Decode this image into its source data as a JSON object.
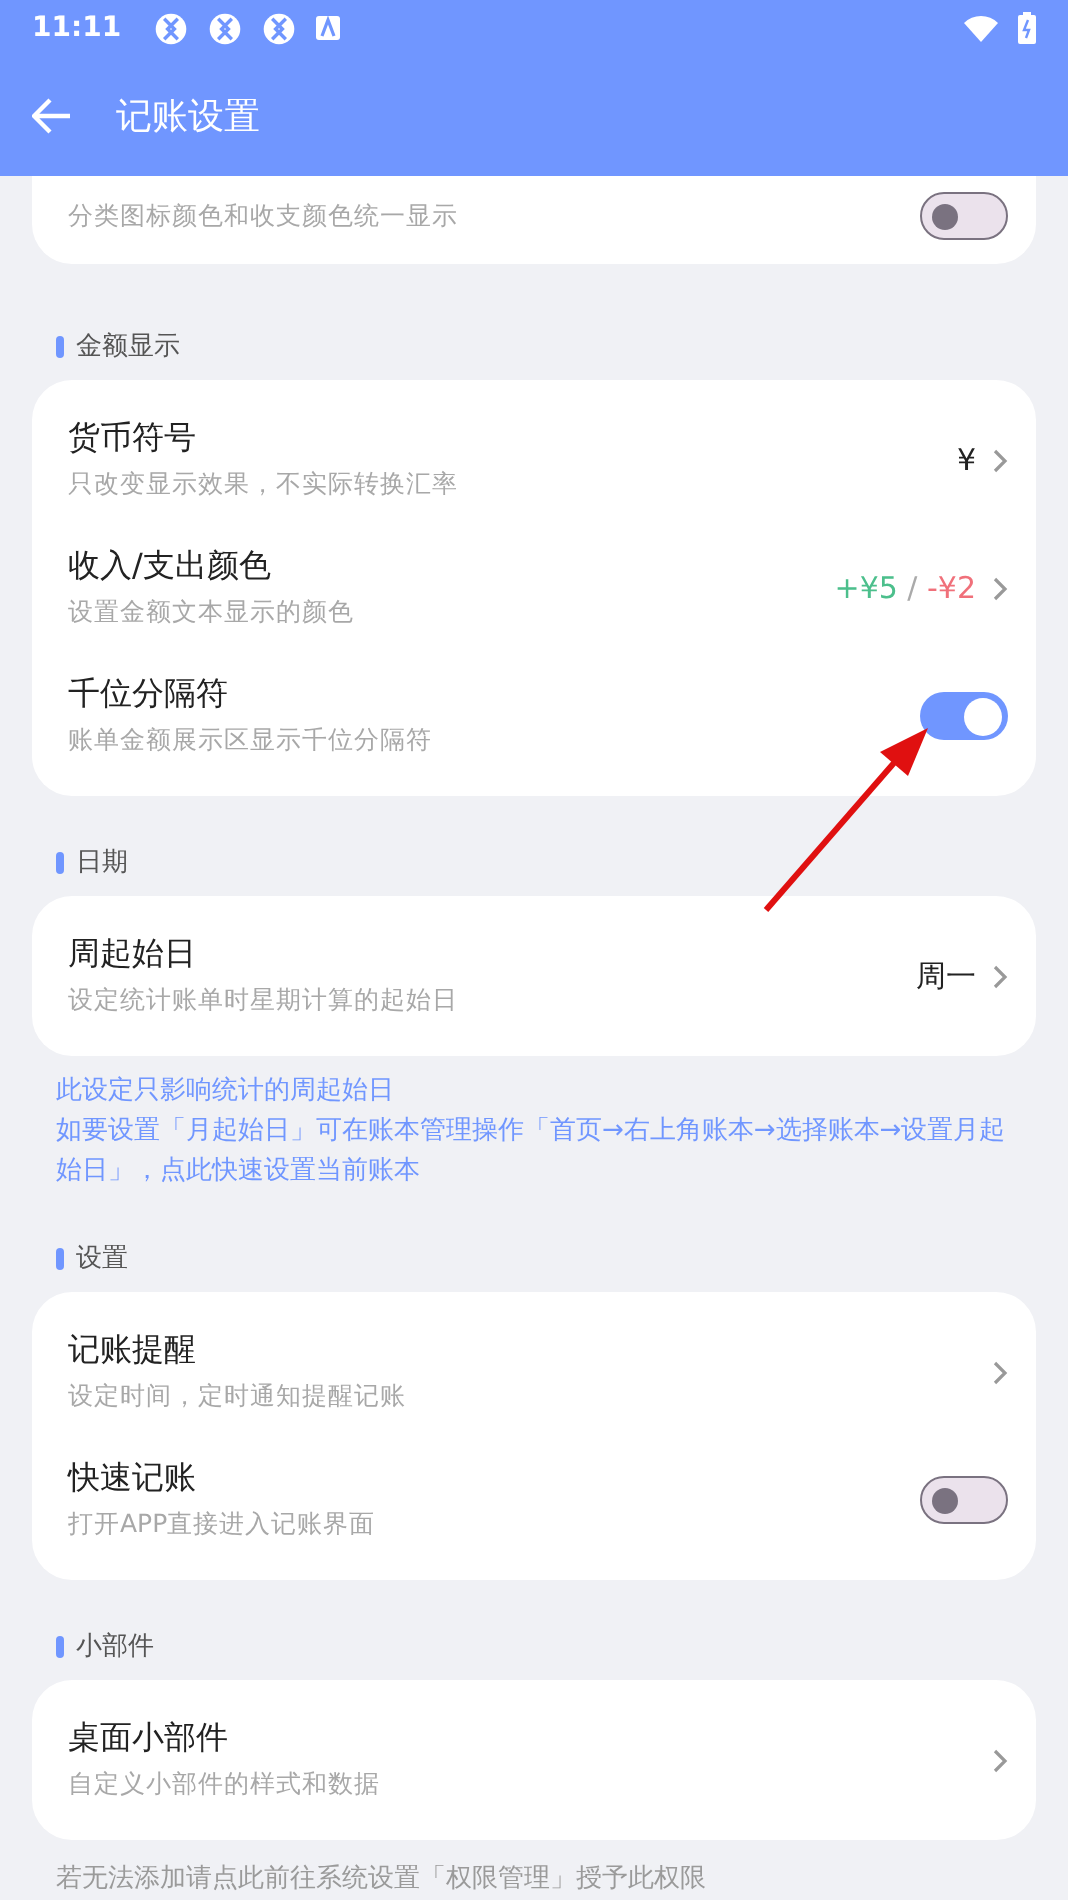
{
  "status_bar": {
    "time": "11:11"
  },
  "app_bar": {
    "title": "记账设置"
  },
  "top_partial_card": {
    "subtitle": "分类图标颜色和收支颜色统一显示",
    "on": false
  },
  "sections": [
    {
      "label": "金额显示",
      "items": [
        {
          "kind": "link",
          "title": "货币符号",
          "subtitle": "只改变显示效果，不实际转换汇率",
          "value_parts": [
            {
              "text": "¥",
              "color": "#222222"
            }
          ]
        },
        {
          "kind": "link",
          "title": "收入/支出颜色",
          "subtitle": "设置金额文本显示的颜色",
          "value_parts": [
            {
              "text": "+¥5",
              "color": "#4cbf8c"
            },
            {
              "text": " / ",
              "color": "#aaaaaa"
            },
            {
              "text": "-¥2",
              "color": "#f0707a"
            }
          ]
        },
        {
          "kind": "toggle",
          "title": "千位分隔符",
          "subtitle": "账单金额展示区显示千位分隔符",
          "on": true
        }
      ]
    },
    {
      "label": "日期",
      "items": [
        {
          "kind": "link",
          "title": "周起始日",
          "subtitle": "设定统计账单时星期计算的起始日",
          "value_parts": [
            {
              "text": "周一",
              "color": "#222222"
            }
          ]
        }
      ],
      "note_lines": [
        "此设定只影响统计的周起始日",
        "如要设置「月起始日」可在账本管理操作「首页→右上角账本→选择账本→设置月起始日」，点此快速设置当前账本"
      ]
    },
    {
      "label": "设置",
      "items": [
        {
          "kind": "link",
          "title": "记账提醒",
          "subtitle": "设定时间，定时通知提醒记账"
        },
        {
          "kind": "toggle",
          "title": "快速记账",
          "subtitle": "打开APP直接进入记账界面",
          "on": false
        }
      ]
    },
    {
      "label": "小部件",
      "items": [
        {
          "kind": "link",
          "title": "桌面小部件",
          "subtitle": "自定义小部件的样式和数据"
        }
      ]
    }
  ],
  "footer_note": "若无法添加请点此前往系统设置「权限管理」授予此权限"
}
